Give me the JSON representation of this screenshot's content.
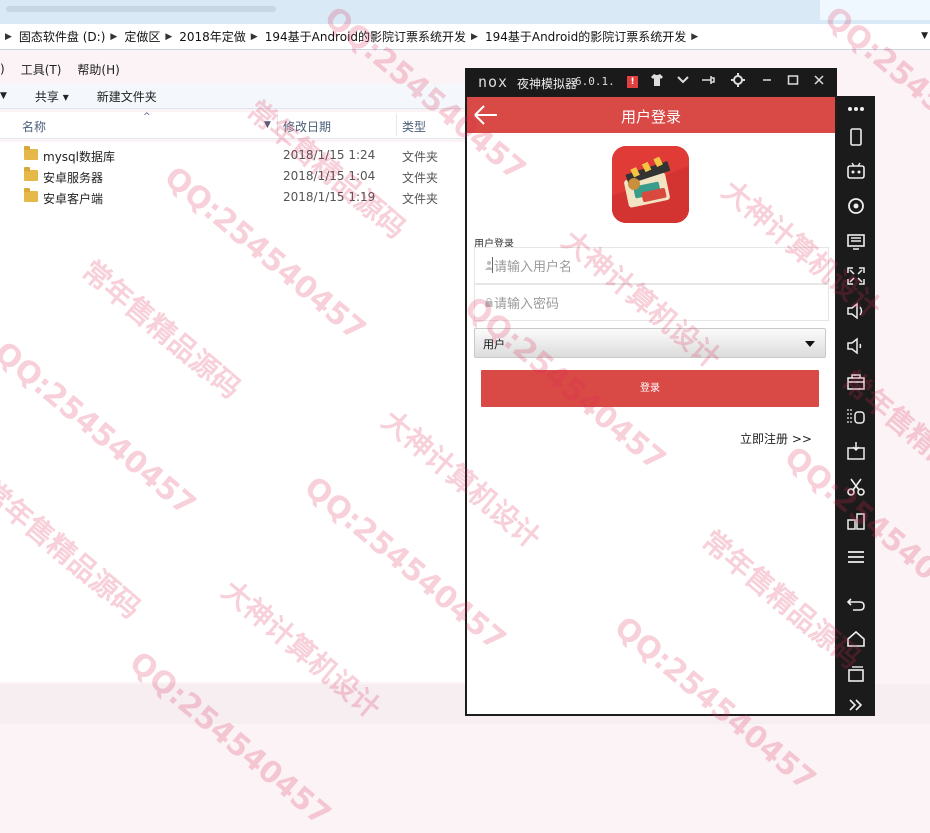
{
  "address_bar": {
    "crumbs": [
      "固态软件盘 (D:)",
      "定做区",
      "2018年定做",
      "194基于Android的影院订票系统开发",
      "194基于Android的影院订票系统开发"
    ]
  },
  "menu": {
    "items": [
      ")",
      "工具(T)",
      "帮助(H)"
    ]
  },
  "toolbar": {
    "share_label": "共享 ▾",
    "new_folder_label": "新建文件夹"
  },
  "columns": {
    "name": "名称",
    "date": "修改日期",
    "type": "类型"
  },
  "files": [
    {
      "name": "mysql数据库",
      "date": "2018/1/15 1:24",
      "type": "文件夹"
    },
    {
      "name": "安卓服务器",
      "date": "2018/1/15 1:04",
      "type": "文件夹"
    },
    {
      "name": "安卓客户端",
      "date": "2018/1/15 1:19",
      "type": "文件夹"
    }
  ],
  "emulator": {
    "logo": "nox",
    "name": "夜神模拟器",
    "version": "6.0.1.",
    "alert": "!"
  },
  "app": {
    "title": "用户登录",
    "form_label": "用户登录",
    "username_placeholder": "请输入用户名",
    "password_placeholder": "请输入密码",
    "role_selected": "用户",
    "login_label": "登录",
    "register_label": "立即注册 >>",
    "accent_color": "#d94a46"
  },
  "sidebar_icons": [
    "more-icon",
    "phone-rotate-icon",
    "robot-icon",
    "location-icon",
    "screen-icon",
    "fullscreen-icon",
    "volume-up-icon",
    "volume-down-icon",
    "toolbox-icon",
    "install-apk-icon",
    "apk-icon",
    "scissors-icon",
    "multi-instance-icon",
    "menu-icon",
    "back-icon",
    "home-icon",
    "recents-icon",
    "expand-icon"
  ],
  "watermark": {
    "texts": [
      "常年售精品源码",
      "QQ:254540457",
      "大神计算机设计"
    ]
  }
}
